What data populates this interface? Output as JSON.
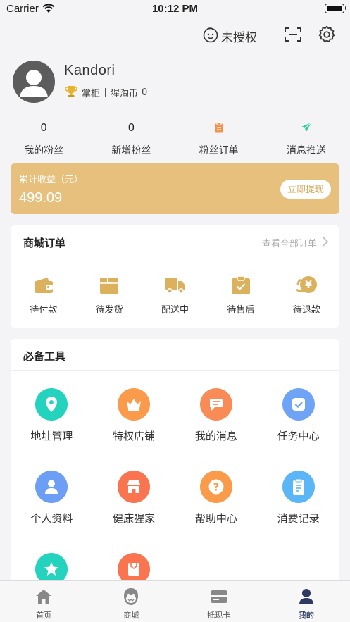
{
  "status_bar": {
    "carrier": "Carrier",
    "time": "10:12 PM"
  },
  "header": {
    "auth_label": "未授权"
  },
  "profile": {
    "name": "Kandori",
    "role": "掌柜",
    "coin_label": "猩淘币",
    "coin_value": "0"
  },
  "stats": [
    {
      "value": "0",
      "label": "我的粉丝"
    },
    {
      "value": "0",
      "label": "新增粉丝"
    },
    {
      "icon": "clipboard-icon",
      "label": "粉丝订单"
    },
    {
      "icon": "paper-plane-icon",
      "label": "消息推送"
    }
  ],
  "earnings": {
    "label": "累计收益（元）",
    "value": "499.09",
    "withdraw_label": "立即提现"
  },
  "orders": {
    "title": "商城订单",
    "view_all": "查看全部订单",
    "items": [
      {
        "label": "待付款",
        "icon": "wallet-icon"
      },
      {
        "label": "待发货",
        "icon": "box-icon"
      },
      {
        "label": "配送中",
        "icon": "truck-icon"
      },
      {
        "label": "待售后",
        "icon": "check-clipboard-icon"
      },
      {
        "label": "待退款",
        "icon": "yen-refund-icon"
      }
    ]
  },
  "tools": {
    "title": "必备工具",
    "items": [
      {
        "label": "地址管理",
        "icon": "location-pin-icon",
        "color": "#23d3bd"
      },
      {
        "label": "特权店铺",
        "icon": "crown-icon",
        "color": "#f99b4a"
      },
      {
        "label": "我的消息",
        "icon": "message-icon",
        "color": "#f98b57"
      },
      {
        "label": "任务中心",
        "icon": "task-check-icon",
        "color": "#6fa3f6"
      },
      {
        "label": "个人资料",
        "icon": "user-icon",
        "color": "#6d9ef5"
      },
      {
        "label": "健康猩家",
        "icon": "store-icon",
        "color": "#f9744f"
      },
      {
        "label": "帮助中心",
        "icon": "question-icon",
        "color": "#f99b4a"
      },
      {
        "label": "消费记录",
        "icon": "record-icon",
        "color": "#5ab6f7"
      },
      {
        "label": "",
        "icon": "star-icon",
        "color": "#23d3bd"
      },
      {
        "label": "",
        "icon": "gift-card-icon",
        "color": "#f9744f"
      }
    ]
  },
  "tabbar": [
    {
      "label": "首页",
      "icon": "home-icon"
    },
    {
      "label": "商城",
      "icon": "gorilla-icon"
    },
    {
      "label": "抵现卡",
      "icon": "card-icon"
    },
    {
      "label": "我的",
      "icon": "profile-icon",
      "active": true
    }
  ],
  "colors": {
    "accent_gold": "#e6c07c",
    "tab_active": "#2f3a63",
    "order_icon": "#dcb15e"
  }
}
